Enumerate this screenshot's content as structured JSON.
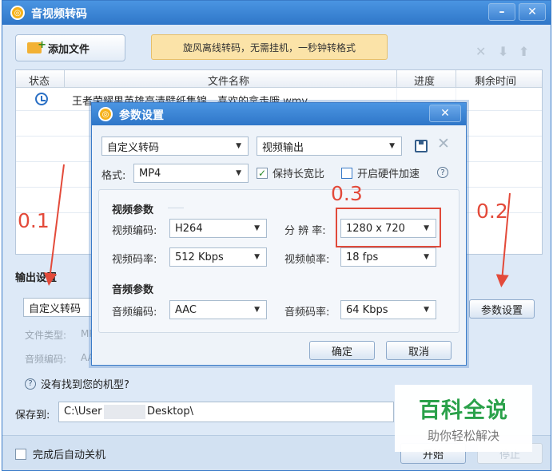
{
  "app": {
    "title": "音视频转码",
    "minimize": "–",
    "close": "✕"
  },
  "toolbar": {
    "add_file_label": "添加文件",
    "promo_text": "旋风离线转码，无需挂机，一秒钟转格式",
    "icons": [
      "close-icon",
      "down-arrow-icon",
      "up-arrow-icon"
    ],
    "icon_glyphs": [
      "✕",
      "⬇",
      "⬆"
    ]
  },
  "table": {
    "columns": [
      "状态",
      "文件名称",
      "进度",
      "剩余时间"
    ],
    "rows": [
      {
        "status_icon": "clock-icon",
        "filename": "王者荣耀男英雄高清壁纸集锦，喜欢的拿走哦.wmv",
        "progress": "",
        "remaining": ""
      }
    ]
  },
  "output": {
    "section_title": "输出设置",
    "preset_value": "自定义转码",
    "file_type_label": "文件类型:",
    "file_type_value": "MP",
    "audio_codec_label": "音频编码:",
    "audio_codec_value": "AA",
    "help_link": "没有找到您的机型?",
    "param_settings_button": "参数设置",
    "save_to_label": "保存到:",
    "save_path_prefix": "C:\\User",
    "save_path_suffix": "Desktop\\",
    "auto_shutdown_label": "完成后自动关机",
    "start_button": "开始",
    "stop_button": "停止"
  },
  "dialog": {
    "title": "参数设置",
    "close": "✕",
    "preset": "自定义转码",
    "output_mode": "视频输出",
    "format_label": "格式:",
    "format_value": "MP4",
    "keep_ratio_label": "保持长宽比",
    "keep_ratio_checked": true,
    "hw_accel_label": "开启硬件加速",
    "hw_accel_checked": false,
    "video_params_title": "视频参数",
    "video_codec_label": "视频编码:",
    "video_codec_value": "H264",
    "resolution_label": "分 辨 率:",
    "resolution_value": "1280 x 720",
    "video_bitrate_label": "视频码率:",
    "video_bitrate_value": "512 Kbps",
    "frame_rate_label": "视频帧率:",
    "frame_rate_value": "18 fps",
    "audio_params_title": "音频参数",
    "audio_codec_label": "音频编码:",
    "audio_codec_value": "AAC",
    "audio_bitrate_label": "音频码率:",
    "audio_bitrate_value": "64 Kbps",
    "ok_button": "确定",
    "cancel_button": "取消"
  },
  "annotations": {
    "label_1": "0.1",
    "label_2": "0.2",
    "label_3": "0.3",
    "color": "#e34a3a"
  },
  "watermark": {
    "title": "百科全说",
    "subtitle": "助你轻松解决"
  },
  "colors": {
    "titlebar": "#2f76c8",
    "window_bg": "#dde9f7",
    "promo_bg": "#fbe3a8",
    "watermark_green": "#2aa14a"
  }
}
